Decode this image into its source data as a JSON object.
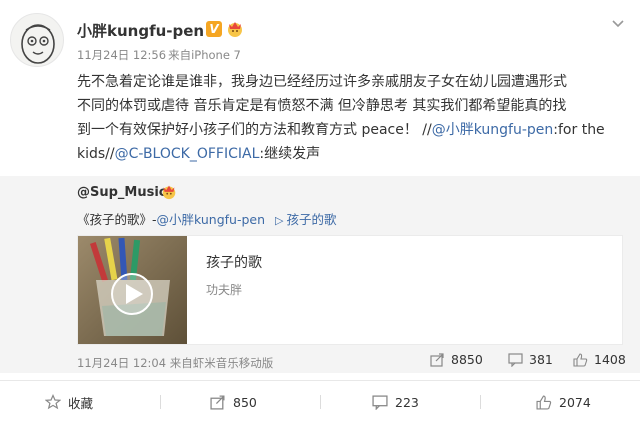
{
  "post": {
    "username": "小胖kungfu-pen",
    "verified_badge": "V",
    "date": "11月24日 12:56",
    "source": "来自iPhone 7",
    "content_lines": [
      "先不急着定论谁是谁非，我身边已经经历过许多亲戚朋友子女在幼儿园遭遇形式",
      "不同的体罚或虐待 音乐肯定是有愤怒不满 但冷静思考 其实我们都希望能真的找",
      "到一个有效保护好小孩子们的方法和教育方式 peace！ //"
    ],
    "mention_self": "@小胖kungfu-pen",
    "line3_tail": ":for the",
    "line4_start": "kids//",
    "mention_official": "@C-BLOCK_OFFICIAL",
    "line4_tail": ":继续发声"
  },
  "repost": {
    "username": "@Sup_Music",
    "song_ref": "《孩子的歌》-",
    "mention": "@小胖kungfu-pen",
    "link_icon": "play-triangle-icon",
    "link_text": "孩子的歌",
    "music_card": {
      "title": "孩子的歌",
      "artist": "功夫胖"
    },
    "date": "11月24日 12:04",
    "source": "来自虾米音乐移动版",
    "forward_count": "8850",
    "comment_count": "381",
    "like_count": "1408"
  },
  "actions": {
    "favorite_label": "收藏",
    "forward_count": "850",
    "comment_count": "223",
    "like_count": "2074"
  },
  "colors": {
    "link": "#3d6aa6",
    "badge": "#f5a623",
    "repost_bg": "#f4f4f4"
  }
}
